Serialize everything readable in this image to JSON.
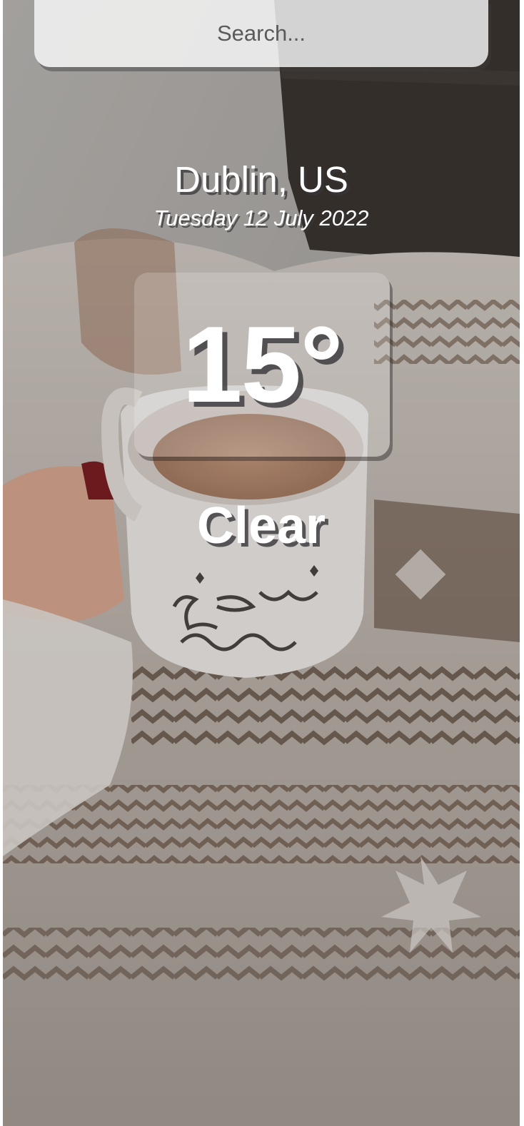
{
  "search": {
    "placeholder": "Search..."
  },
  "weather": {
    "location": "Dublin, US",
    "date": "Tuesday 12 July 2022",
    "temperature": "15°",
    "condition": "Clear"
  },
  "background": {
    "description_icon": "coffee-mug-photo",
    "colors": {
      "wall": "#b8b4b0",
      "cushion": "#3a332f",
      "blanket_light": "#ded8d2",
      "blanket_dark": "#5a4435",
      "coffee": "#b88c70"
    }
  }
}
